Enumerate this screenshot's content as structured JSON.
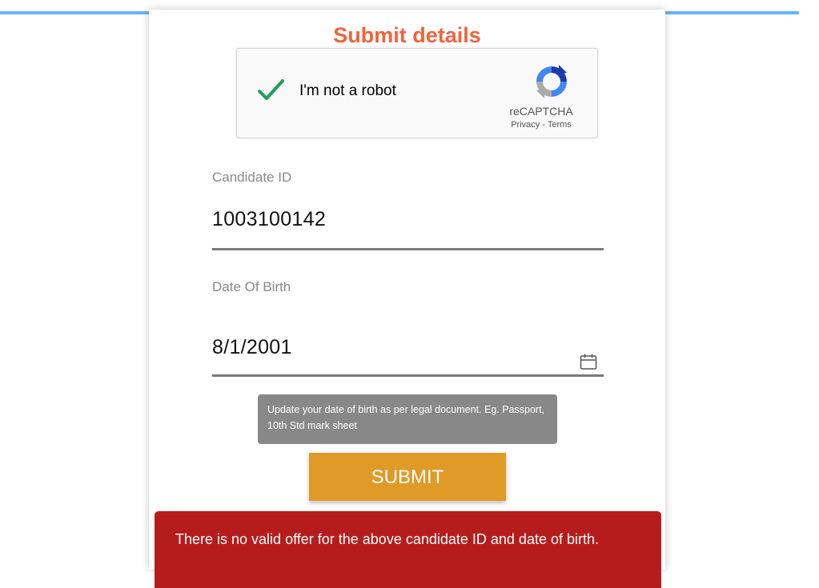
{
  "page": {
    "title": "Submit details"
  },
  "captcha": {
    "label": "I'm not a robot",
    "brand": "reCAPTCHA",
    "links": "Privacy - Terms",
    "checked": true
  },
  "form": {
    "candidate_id": {
      "label": "Candidate ID",
      "value": "1003100142"
    },
    "dob": {
      "label": "Date Of Birth",
      "value": "8/1/2001",
      "hint": "Update your date of birth as per legal document. Eg. Passport, 10th Std mark sheet"
    },
    "submit_label": "SUBMIT"
  },
  "error": {
    "message": "There is no valid offer for the above candidate ID and date of birth."
  },
  "colors": {
    "accent_bar": "#64b5f6",
    "title": "#f0643c",
    "submit_bg": "#e09a28",
    "error_bg": "#b71c1c",
    "tooltip_bg": "#888888"
  },
  "icons": {
    "check": "checkmark-icon",
    "captcha_logo": "recaptcha-logo-icon",
    "calendar": "calendar-icon"
  }
}
